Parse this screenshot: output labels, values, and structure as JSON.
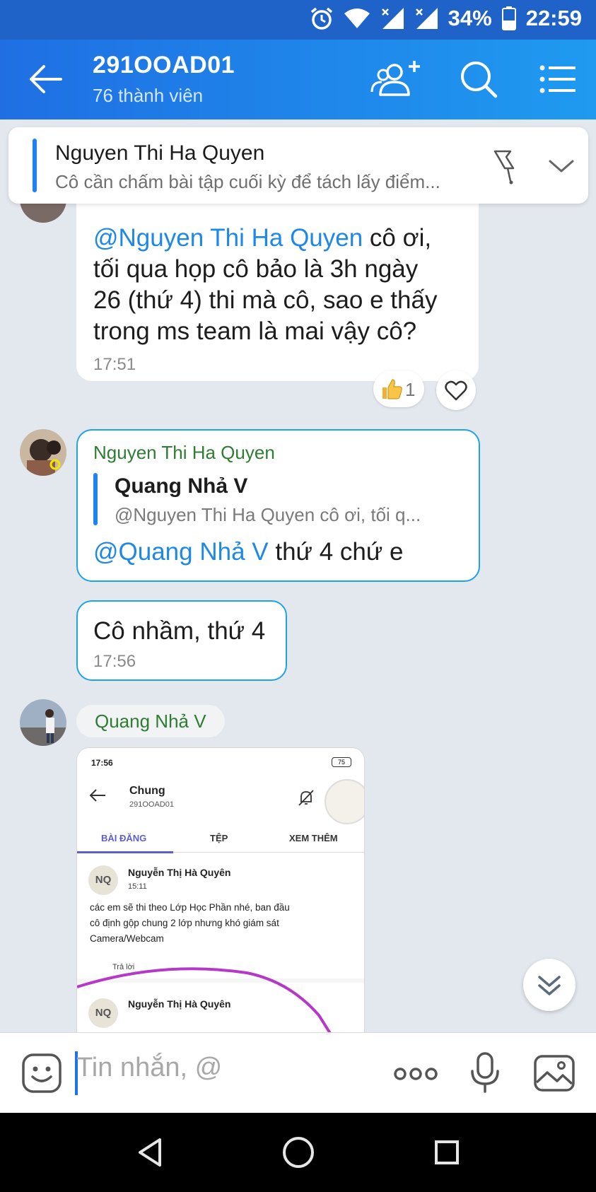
{
  "status_bar": {
    "battery": "34%",
    "time": "22:59"
  },
  "header": {
    "title": "291OOAD01",
    "member_count": "76 thành viên"
  },
  "pinned": {
    "name": "Nguyen Thi Ha Quyen",
    "text": "Cô cần chấm bài tập cuối kỳ để tách lấy điểm..."
  },
  "messages": {
    "m1": {
      "mention": "@Nguyen Thi Ha Quyen",
      "body_line1": " cô ơi,",
      "body_line2": "tối qua họp cô bảo là 3h ngày",
      "body_line3": "26 (thứ 4) thi mà cô, sao e thấy",
      "body_line4": "trong ms team là mai vậy cô?",
      "time": "17:51",
      "reaction_count": "1"
    },
    "m2": {
      "sender": "Nguyen Thi Ha Quyen",
      "quote_name": "Quang Nhả V",
      "quote_text": "@Nguyen Thi Ha Quyen  cô ơi, tối q...",
      "mention": "@Quang Nhả V",
      "body": " thứ 4 chứ e"
    },
    "m3": {
      "body": "Cô nhầm, thứ 4",
      "time": "17:56"
    },
    "m4": {
      "sender": "Quang Nhả V"
    }
  },
  "shared_image": {
    "time": "17:56",
    "battery": "75",
    "title": "Chung",
    "subtitle": "291OOAD01",
    "tabs": [
      "BÀI ĐĂNG",
      "TỆP",
      "XEM THÊM"
    ],
    "post1": {
      "initials": "NQ",
      "author": "Nguyễn Thị Hà Quyên",
      "time": "15:11",
      "line1": "các em sẽ thi theo Lớp Học Phần nhé, ban đầu",
      "line2": "cô định gộp chung 2 lớp nhưng khó giám sát",
      "line3": "Camera/Webcam",
      "reply": "Trả lời"
    },
    "post2": {
      "initials": "NQ",
      "author": "Nguyễn Thị Hà Quyên"
    }
  },
  "composer": {
    "placeholder": "Tin nhắn, @"
  },
  "colors": {
    "header": "#1f8ae8",
    "mention": "#1e88e5",
    "sender_green": "#2e7d32",
    "selected_border": "#1ea3e6"
  },
  "icons": [
    "back-icon",
    "add-member-icon",
    "search-icon",
    "menu-icon",
    "pin-icon",
    "chevron-down-icon",
    "like-icon",
    "heart-icon",
    "scroll-down-icon",
    "emoji-icon",
    "more-icon",
    "mic-icon",
    "image-icon"
  ]
}
